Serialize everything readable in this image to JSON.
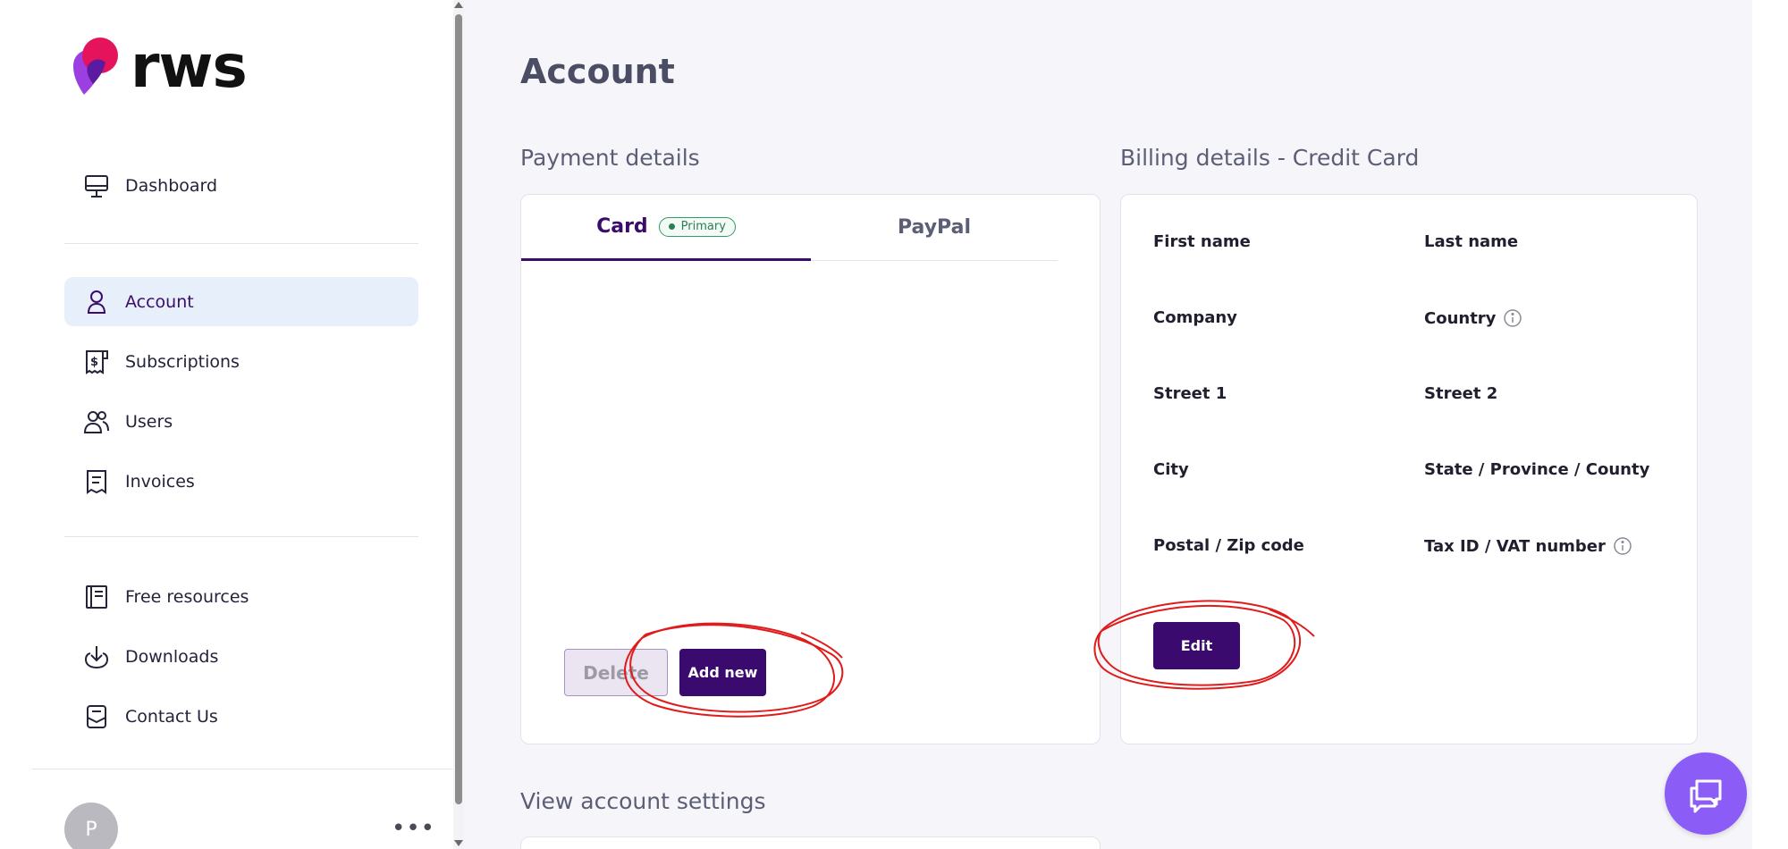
{
  "brand": {
    "wordmark": "rws"
  },
  "sidebar": {
    "items": [
      {
        "label": "Dashboard",
        "icon": "monitor-icon"
      },
      {
        "label": "Account",
        "icon": "user-icon",
        "active": true
      },
      {
        "label": "Subscriptions",
        "icon": "dollar-receipt-icon"
      },
      {
        "label": "Users",
        "icon": "users-icon"
      },
      {
        "label": "Invoices",
        "icon": "invoice-icon"
      },
      {
        "label": "Free resources",
        "icon": "book-icon"
      },
      {
        "label": "Downloads",
        "icon": "download-icon"
      },
      {
        "label": "Contact Us",
        "icon": "contact-icon"
      }
    ],
    "avatar_initial": "P",
    "more_label": "•••"
  },
  "page": {
    "title": "Account",
    "payment_section_title": "Payment details",
    "billing_section_title": "Billing details - Credit Card",
    "settings_section_title": "View account settings"
  },
  "payment": {
    "tabs": [
      {
        "label": "Card",
        "active": true,
        "badge": "Primary"
      },
      {
        "label": "PayPal",
        "active": false
      }
    ],
    "delete_label": "Delete",
    "add_new_label": "Add new"
  },
  "billing": {
    "fields": [
      "First name",
      "Last name",
      "Company",
      "Country",
      "Street 1",
      "Street 2",
      "City",
      "State / Province / County",
      "Postal / Zip code",
      "Tax ID / VAT number"
    ],
    "edit_label": "Edit"
  },
  "colors": {
    "accent": "#3b0a6e",
    "active_nav_bg": "#e7effb",
    "badge_green": "#2f9a63",
    "chat_button": "#8b5cf6",
    "annotation_red": "#e01b1b"
  }
}
